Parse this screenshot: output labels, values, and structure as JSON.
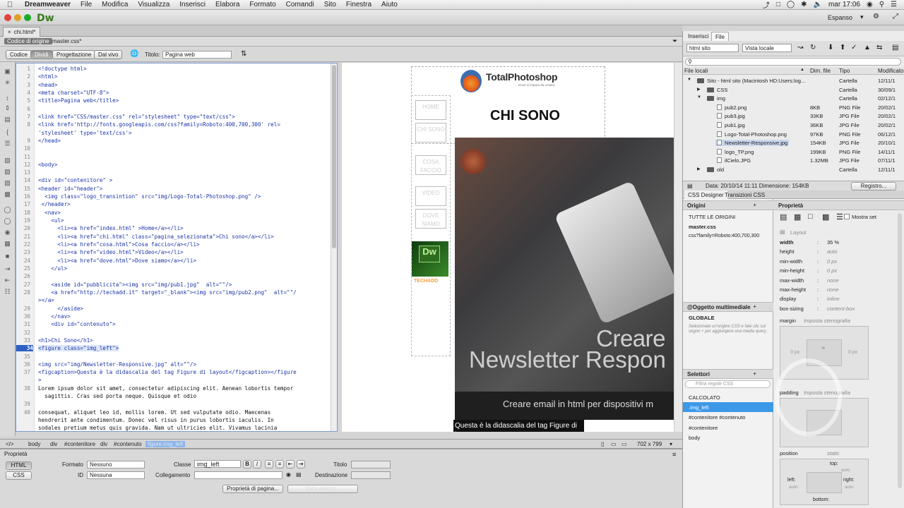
{
  "menubar": {
    "app": "Dreamweaver",
    "items": [
      "File",
      "Modifica",
      "Visualizza",
      "Inserisci",
      "Elabora",
      "Formato",
      "Comandi",
      "Sito",
      "Finestra",
      "Aiuto"
    ],
    "clock": "mar 17:06"
  },
  "appbar": {
    "logo": "Dw",
    "workspace": "Espanso"
  },
  "document": {
    "tab": "chi.html*",
    "related_files": [
      "Codice di origine",
      "master.css*"
    ],
    "views": [
      "Codice",
      "Dividi",
      "Progettazione",
      "Dal vivo"
    ],
    "active_view": "Dividi",
    "title_label": "Titolo:",
    "title_value": "Pagina web"
  },
  "code": {
    "lines": [
      {
        "n": "1",
        "t": "<!doctype html>"
      },
      {
        "n": "2",
        "t": "<html>"
      },
      {
        "n": "3",
        "t": "<head>"
      },
      {
        "n": "4",
        "t": "<meta charset=\"UTF-8\">"
      },
      {
        "n": "5",
        "t": "<title>Pagina web</title>"
      },
      {
        "n": "6",
        "t": ""
      },
      {
        "n": "7",
        "t": "<link href=\"CSS/master.css\" rel=\"stylesheet\" type=\"text/css\">"
      },
      {
        "n": "8",
        "t": "<link href='http://fonts.googleapis.com/css?family=Roboto:400,700,300' rel="
      },
      {
        "n": "",
        "t": "'stylesheet' type='text/css'>"
      },
      {
        "n": "9",
        "t": "</head>"
      },
      {
        "n": "10",
        "t": ""
      },
      {
        "n": "11",
        "t": ""
      },
      {
        "n": "12",
        "t": "<body>"
      },
      {
        "n": "13",
        "t": ""
      },
      {
        "n": "14",
        "t": "<div id=\"contenitore\" >"
      },
      {
        "n": "15",
        "t": "<header id=\"header\">"
      },
      {
        "n": "16",
        "t": "  <img class=\"logo_transintion\" src=\"img/Logo-Total-Photoshop.png\" />"
      },
      {
        "n": "17",
        "t": " </header>"
      },
      {
        "n": "18",
        "t": "  <nav>"
      },
      {
        "n": "19",
        "t": "    <ul>"
      },
      {
        "n": "20",
        "t": "      <li><a href=\"index.html\" >Home</a></li>"
      },
      {
        "n": "21",
        "t": "      <li><a href=\"chi.html\" class=\"pagina_selezionata\">Chi sono</a></li>"
      },
      {
        "n": "22",
        "t": "      <li><a href=\"cosa.html\">Cosa faccio</a></li>"
      },
      {
        "n": "23",
        "t": "      <li><a href=\"video.html\">Video</a></li>"
      },
      {
        "n": "24",
        "t": "      <li><a href=\"dove.html\">Dove siamo</a></li>"
      },
      {
        "n": "25",
        "t": "    </ul>"
      },
      {
        "n": "26",
        "t": ""
      },
      {
        "n": "27",
        "t": "    <aside id=\"pubblicita\"><img src=\"img/pub1.jpg\"  alt=\"\"/>"
      },
      {
        "n": "28",
        "t": "    <a href=\"http://techadd.it\" target=\"_blank\"><img src=\"img/pub2.png\"  alt=\"\"/"
      },
      {
        "n": "",
        "t": "></a>"
      },
      {
        "n": "29",
        "t": "      </aside>"
      },
      {
        "n": "30",
        "t": "    </nav>"
      },
      {
        "n": "31",
        "t": "    <div id=\"contenuto\">"
      },
      {
        "n": "32",
        "t": ""
      },
      {
        "n": "33",
        "t": "<h1>Chi Sono</h1>"
      },
      {
        "n": "34",
        "t": "<figure class=\"img_left\">",
        "current": true
      },
      {
        "n": "35",
        "t": ""
      },
      {
        "n": "36",
        "t": "<img src=\"img/Newsletter-Responsive.jpg\" alt=\"\"/>"
      },
      {
        "n": "37",
        "t": "<figcaption>Questa è la didascalia del tag Figure di layout</figcaption></figure"
      },
      {
        "n": "",
        "t": ">"
      },
      {
        "n": "38",
        "t": "Lorem ipsum dolor sit amet, consectetur adipiscing elit. Aenean lobortis tempor"
      },
      {
        "n": "",
        "t": "  sagittis. Cras sed porta neque. Quisque et odio"
      },
      {
        "n": "39",
        "t": ""
      },
      {
        "n": "40",
        "t": "consequat, aliquet leo id, mollis lorem. Ut sed vulputate odio. Maecenas"
      },
      {
        "n": "",
        "t": "hendrerit ante condimentum. Donec vel risus in purus lobortis iaculis. In"
      },
      {
        "n": "",
        "t": "sodales pretium metus quis gravida. Nam ut ultricies elit. Vivamus lacinia"
      }
    ]
  },
  "live": {
    "logo_text": "TotalPhotoshop",
    "logo_sub": "Dove si impara da creativi",
    "heading": "CHI SONO",
    "nav": [
      "HOME",
      "CHI SONO",
      "COSA FACCIO",
      "VIDEO",
      "DOVE SIAMO"
    ],
    "ad_label": "Dw",
    "ad2": "TECHADD",
    "hero_big1": "Creare",
    "hero_big2": "Newsletter Respon",
    "hero_sub": "Creare email in html per dispositivi m",
    "caption": "Questa è la didascalia del tag Figure di layout"
  },
  "tagbar": {
    "tags": [
      "</>",
      "body",
      "div",
      "#contenitore",
      "div",
      "#contenuto",
      "figure",
      "img_left"
    ],
    "size": "702 x 799"
  },
  "properties": {
    "title": "Proprietà",
    "mode_html": "HTML",
    "mode_css": "CSS",
    "formato_label": "Formato",
    "formato_value": "Nessuno",
    "classe_label": "Classe",
    "classe_value": "img_left",
    "titolo_label": "Titolo",
    "id_label": "ID",
    "id_value": "Nessuna",
    "collegamento_label": "Collegamento",
    "destinazione_label": "Destinazione",
    "page_props_btn": "Proprietà di pagina...",
    "list_btn": "Voce elenco..."
  },
  "files": {
    "tabs": [
      "Inserisci",
      "File"
    ],
    "site_select": "html sito",
    "view_select": "Vista locale",
    "headers": [
      "File locali",
      "Dim. file",
      "Tipo",
      "Modificato"
    ],
    "rows": [
      {
        "indent": 0,
        "name": "Sito - html sito (Macintosh HD:Users:log...",
        "size": "",
        "type": "Cartella",
        "mod": "12/11/1",
        "kind": "folder"
      },
      {
        "indent": 1,
        "name": "CSS",
        "size": "",
        "type": "Cartella",
        "mod": "30/09/1",
        "kind": "folder"
      },
      {
        "indent": 1,
        "name": "img",
        "size": "",
        "type": "Cartella",
        "mod": "02/12/1",
        "kind": "folder"
      },
      {
        "indent": 2,
        "name": "pub2.png",
        "size": "8KB",
        "type": "PNG File",
        "mod": "20/02/1",
        "kind": "file"
      },
      {
        "indent": 2,
        "name": "pub3.jpg",
        "size": "33KB",
        "type": "JPG File",
        "mod": "20/02/1",
        "kind": "file"
      },
      {
        "indent": 2,
        "name": "pub1.jpg",
        "size": "36KB",
        "type": "JPG File",
        "mod": "20/02/1",
        "kind": "file"
      },
      {
        "indent": 2,
        "name": "Logo-Total-Photoshop.png",
        "size": "97KB",
        "type": "PNG File",
        "mod": "06/12/1",
        "kind": "file"
      },
      {
        "indent": 2,
        "name": "Newsletter-Responsive.jpg",
        "size": "154KB",
        "type": "JPG File",
        "mod": "20/10/1",
        "kind": "file",
        "selected": true
      },
      {
        "indent": 2,
        "name": "logo_TP.png",
        "size": "199KB",
        "type": "PNG File",
        "mod": "14/11/1",
        "kind": "file"
      },
      {
        "indent": 2,
        "name": "ilCielo.JPG",
        "size": "1.32MB",
        "type": "JPG File",
        "mod": "07/11/1",
        "kind": "file"
      },
      {
        "indent": 1,
        "name": "old",
        "size": "",
        "type": "Cartella",
        "mod": "12/11/1",
        "kind": "folder"
      }
    ],
    "status": "Data: 20/10/14 11:11  Dimensione: 154KB",
    "registro": "Registro..."
  },
  "css_designer": {
    "tabs": [
      "CSS Designer",
      "Transizioni CSS"
    ],
    "origini_title": "Origini",
    "origini": [
      "TUTTE LE ORIGINI",
      "master.css",
      "css?family=Roboto:400,700,300"
    ],
    "media_title": "@Oggetto multimediale",
    "media_global": "GLOBALE",
    "media_hint": "Selezionate un'origine CSS e fate clic sul segno + per aggiungere una media query.",
    "selettori_title": "Selettori",
    "filter_placeholder": "Filtra regole CSS",
    "selectors": [
      "CALCOLATO",
      ".img_left",
      "#contenitore #contenuto",
      "#contenitore",
      "body"
    ],
    "active_selector": 1,
    "proprieta_title": "Proprietà",
    "mostra_set": "Mostra set",
    "layout_label": "Layout",
    "props": [
      {
        "name": "width",
        "value": "35 %",
        "set": true
      },
      {
        "name": "height",
        "value": "auto"
      },
      {
        "name": "min-width",
        "value": "0 px"
      },
      {
        "name": "min-height",
        "value": "0 px"
      },
      {
        "name": "max-width",
        "value": "none"
      },
      {
        "name": "max-height",
        "value": "none"
      },
      {
        "name": "display",
        "value": "inline"
      },
      {
        "name": "box-sizing",
        "value": "content-box"
      }
    ],
    "margin_label": "margin",
    "margin_hint": "Imposta stenografia",
    "margin_vals": "0 px",
    "padding_label": "padding",
    "padding_hint": "Imposta stenografia",
    "position_label": "position",
    "position_value": "static",
    "top_label": "top:",
    "left_label": "left:",
    "right_label": "right:",
    "bottom_label": "bottom:",
    "auto": "auto"
  }
}
